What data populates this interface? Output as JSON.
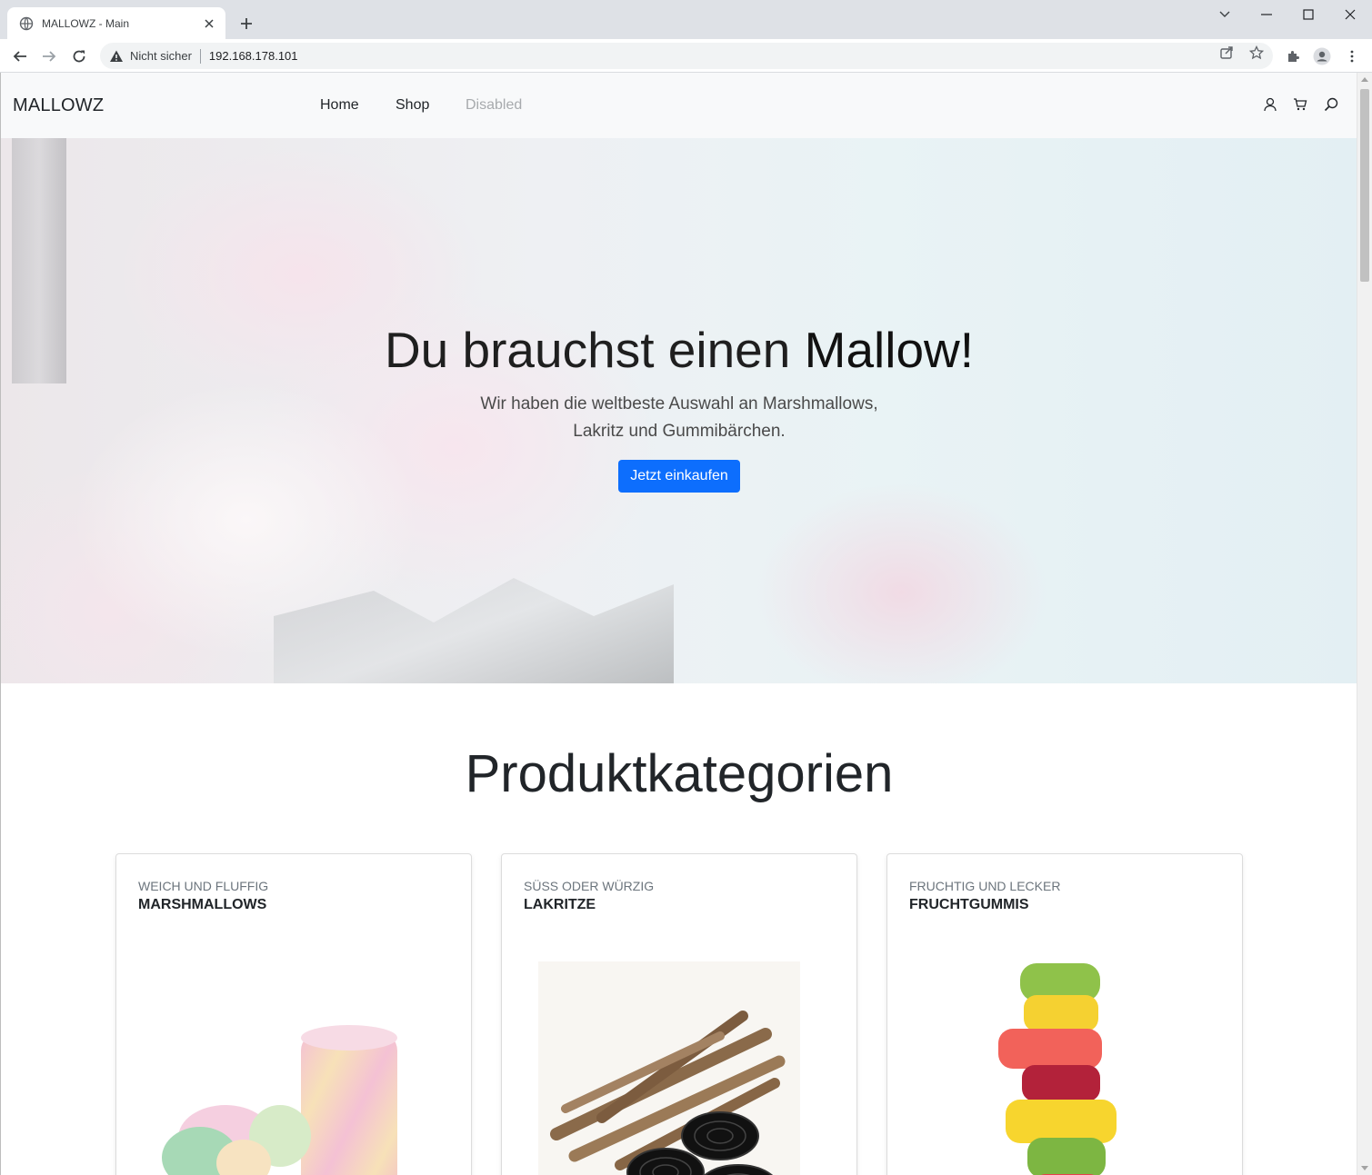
{
  "browser": {
    "tab_title": "MALLOWZ - Main",
    "security_label": "Nicht sicher",
    "url": "192.168.178.101"
  },
  "navbar": {
    "brand": "MALLOWZ",
    "links": [
      {
        "label": "Home",
        "disabled": false
      },
      {
        "label": "Shop",
        "disabled": false
      },
      {
        "label": "Disabled",
        "disabled": true
      }
    ],
    "icons": [
      "user-icon",
      "cart-icon",
      "search-icon"
    ]
  },
  "hero": {
    "title_light": "Du brauchst einen ",
    "title_bold": "Mallow!",
    "lead_line1": "Wir haben die weltbeste Auswahl an Marshmallows,",
    "lead_line2": "Lakritz und Gummibärchen.",
    "button_label": "Jetzt einkaufen",
    "button_color": "#0d6efd"
  },
  "categories": {
    "title": "Produktkategorien",
    "items": [
      {
        "kicker": "Weich und fluffig",
        "title": "Marshmallows"
      },
      {
        "kicker": "Süß oder würzig",
        "title": "Lakritze"
      },
      {
        "kicker": "Fruchtig und lecker",
        "title": "Fruchtgummis"
      }
    ]
  }
}
